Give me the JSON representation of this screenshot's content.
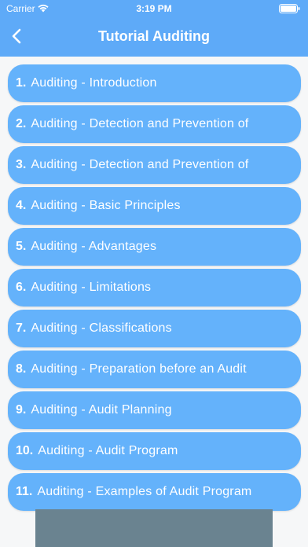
{
  "status_bar": {
    "carrier": "Carrier",
    "time": "3:19 PM",
    "icons": [
      "wifi-icon",
      "battery-icon"
    ]
  },
  "header": {
    "title": "Tutorial Auditing",
    "back_icon": "chevron-left-icon",
    "background_color": "#5eaaf8"
  },
  "list": {
    "item_color": "#64b2fb",
    "items": [
      {
        "num": "1.",
        "label": "Auditing - Introduction"
      },
      {
        "num": "2.",
        "label": "Auditing - Detection and Prevention of"
      },
      {
        "num": "3.",
        "label": "Auditing - Detection and Prevention of"
      },
      {
        "num": "4.",
        "label": "Auditing - Basic Principles"
      },
      {
        "num": "5.",
        "label": "Auditing - Advantages"
      },
      {
        "num": "6.",
        "label": "Auditing - Limitations"
      },
      {
        "num": "7.",
        "label": "Auditing - Classifications"
      },
      {
        "num": "8.",
        "label": "Auditing - Preparation before an Audit"
      },
      {
        "num": "9.",
        "label": "Auditing - Audit Planning"
      },
      {
        "num": "10.",
        "label": "Auditing - Audit Program"
      },
      {
        "num": "11.",
        "label": "Auditing - Examples of Audit Program"
      }
    ]
  }
}
